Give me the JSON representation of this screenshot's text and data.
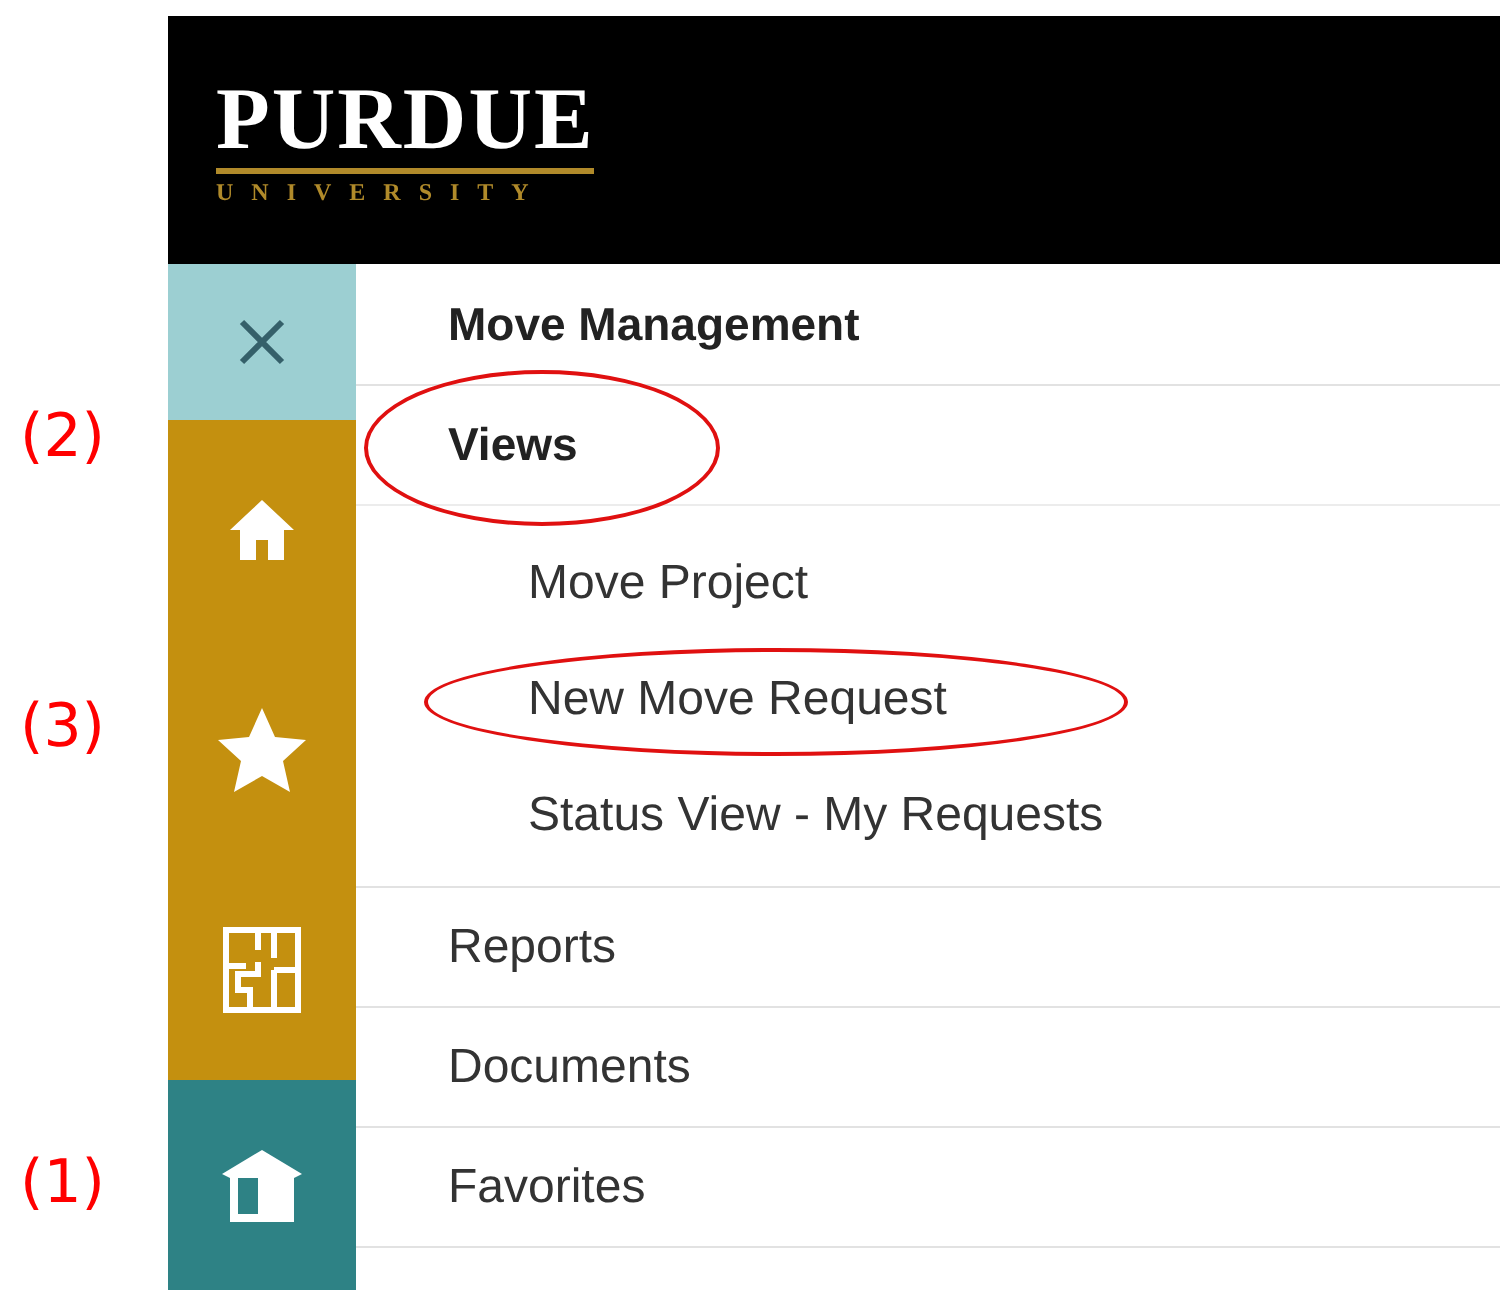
{
  "logo": {
    "name": "PURDUE",
    "subtitle": "UNIVERSITY"
  },
  "sidebar": [
    {
      "kind": "close"
    },
    {
      "kind": "home",
      "callout": "(2)"
    },
    {
      "kind": "star",
      "callout": "(3)"
    },
    {
      "kind": "floorplan"
    },
    {
      "kind": "box",
      "callout": "(1)"
    }
  ],
  "menu": {
    "title": "Move Management",
    "items": [
      {
        "label": "Views",
        "circled": true,
        "children": [
          {
            "label": "Move Project",
            "circled": false
          },
          {
            "label": "New Move Request",
            "circled": true
          },
          {
            "label": "Status View - My Requests",
            "circled": false
          }
        ]
      },
      {
        "label": "Reports",
        "circled": false
      },
      {
        "label": "Documents",
        "circled": false
      },
      {
        "label": "Favorites",
        "circled": false
      }
    ]
  }
}
